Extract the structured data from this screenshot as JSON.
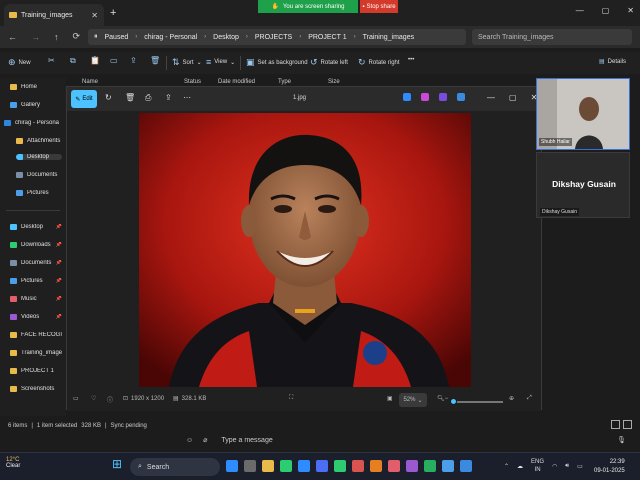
{
  "window": {
    "tab_title": "Training_images",
    "tab_close": "✕",
    "new_tab": "+",
    "controls": [
      "—",
      "▢",
      "✕"
    ]
  },
  "share": {
    "banner": "You are screen sharing",
    "stop": "Stop share"
  },
  "address": {
    "crumbs": [
      "Paused",
      "chirag - Personal",
      "Desktop",
      "PROJECTS",
      "PROJECT 1",
      "Training_images"
    ],
    "search_placeholder": "Search Training_images"
  },
  "commands": {
    "new": "New",
    "sort": "Sort",
    "view": "View",
    "set_background": "Set as background",
    "rotate_left": "Rotate left",
    "rotate_right": "Rotate right",
    "more": "•••",
    "details": "Details"
  },
  "columns": [
    "Name",
    "Status",
    "Date modified",
    "Type",
    "Size"
  ],
  "sidebar": [
    {
      "label": "Home",
      "color": "#e9b949",
      "pin": ""
    },
    {
      "label": "Gallery",
      "color": "#4c9ee8",
      "pin": ""
    },
    {
      "label": "chirag - Persona",
      "color": "#2e86de",
      "pin": ""
    },
    {
      "label": "Attachments",
      "color": "#e9b949",
      "pin": ""
    },
    {
      "label": "Desktop",
      "color": "#4cc2ff",
      "pin": ""
    },
    {
      "label": "Documents",
      "color": "#7a8fa6",
      "pin": ""
    },
    {
      "label": "Pictures",
      "color": "#4c9ee8",
      "pin": ""
    },
    {
      "label": "Desktop",
      "color": "#4cc2ff",
      "pin": "📌"
    },
    {
      "label": "Downloads",
      "color": "#2ecc71",
      "pin": "📌"
    },
    {
      "label": "Documents",
      "color": "#7a8fa6",
      "pin": "📌"
    },
    {
      "label": "Pictures",
      "color": "#4c9ee8",
      "pin": "📌"
    },
    {
      "label": "Music",
      "color": "#e35d6a",
      "pin": "📌"
    },
    {
      "label": "Videos",
      "color": "#9b59d0",
      "pin": "📌"
    },
    {
      "label": "FACE RECOGI",
      "color": "#e9b949",
      "pin": "📌"
    },
    {
      "label": "Training_images",
      "color": "#e9b949",
      "pin": ""
    },
    {
      "label": "PROJECT 1",
      "color": "#e9b949",
      "pin": ""
    },
    {
      "label": "Screenshots",
      "color": "#e9b949",
      "pin": ""
    }
  ],
  "viewer": {
    "edit": "Edit",
    "file_name": "1.jpg",
    "resolution": "1920 x 1200",
    "file_size": "328.1 KB",
    "zoom": "52%",
    "zoom_fraction": 0.52,
    "app_colors": [
      "#2f8cff",
      "#c94ad8",
      "#7b4ae0",
      "#3a8be0"
    ]
  },
  "meeting": {
    "participant1": "Shubh Hailar",
    "participant2": "Dikshay Gusain",
    "participant2_label": "Dikshay Gusain"
  },
  "statusbar": {
    "items": "6 items",
    "selected": "1 item selected",
    "size": "328 KB",
    "sync": "Sync pending"
  },
  "chat": {
    "placeholder": "Type a message"
  },
  "taskbar": {
    "temp": "12°C",
    "weather": "Clear",
    "search": "Search",
    "lang1": "ENG",
    "lang2": "IN",
    "time": "22:39",
    "date": "09-01-2025",
    "apps": [
      "#2f8cff",
      "#6b6b6b",
      "#e9b949",
      "#2ecc71",
      "#2f8cff",
      "#4c6ef5",
      "#2ecc71",
      "#d9534f",
      "#e67e22",
      "#e35d6a",
      "#9b59d0",
      "#27ae60",
      "#4c9ee8",
      "#3a8be0"
    ]
  }
}
